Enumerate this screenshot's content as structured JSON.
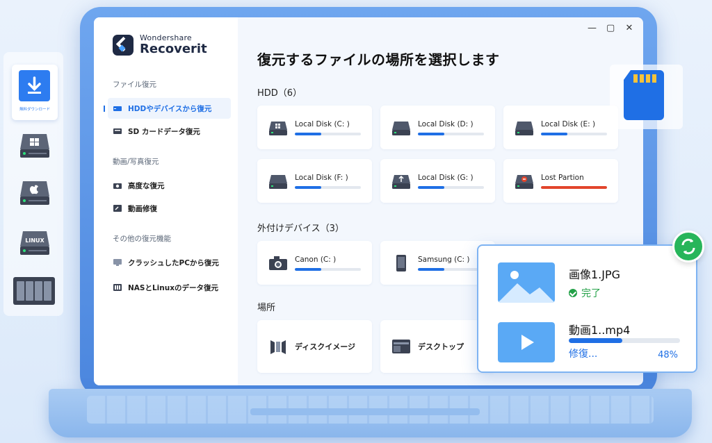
{
  "app": {
    "brand_top": "Wondershare",
    "brand_bottom": "Recoverit",
    "window_controls": {
      "minimize": "—",
      "maximize": "▢",
      "close": "✕"
    }
  },
  "sidebar": {
    "sections": [
      {
        "heading": "ファイル復元",
        "items": [
          {
            "label": "HDDやデバイスから復元",
            "icon": "hdd-icon",
            "active": true
          },
          {
            "label": "SD カードデータ復元",
            "icon": "sd-card-icon",
            "active": false
          }
        ]
      },
      {
        "heading": "動画/写真復元",
        "items": [
          {
            "label": "高度な復元",
            "icon": "camera-icon",
            "active": false
          },
          {
            "label": "動画修復",
            "icon": "video-repair-icon",
            "active": false
          }
        ]
      },
      {
        "heading": "その他の復元機能",
        "items": [
          {
            "label": "クラッシュしたPCから復元",
            "icon": "monitor-icon",
            "active": false
          },
          {
            "label": "NASとLinuxのデータ復元",
            "icon": "nas-icon",
            "active": false
          }
        ]
      }
    ]
  },
  "main": {
    "title": "復元するファイルの場所を選択します",
    "hdd": {
      "heading": "HDD（6）",
      "disks": [
        {
          "label": "Local Disk (C: )",
          "icon": "windows-disk-icon",
          "usage": 0.4,
          "color": "#1f6fe5"
        },
        {
          "label": "Local Disk (D: )",
          "icon": "disk-icon",
          "usage": 0.4,
          "color": "#1f6fe5"
        },
        {
          "label": "Local Disk (E: )",
          "icon": "disk-icon",
          "usage": 0.4,
          "color": "#1f6fe5"
        },
        {
          "label": "Local Disk (F: )",
          "icon": "disk-icon",
          "usage": 0.4,
          "color": "#1f6fe5"
        },
        {
          "label": "Local Disk (G: )",
          "icon": "usb-disk-icon",
          "usage": 0.4,
          "color": "#1f6fe5"
        },
        {
          "label": "Lost Partion",
          "icon": "lost-partition-icon",
          "usage": 1.0,
          "color": "#e2452c"
        }
      ]
    },
    "external": {
      "heading": "外付けデバイス（3）",
      "devices": [
        {
          "label": "Canon (C: )",
          "icon": "camera-device-icon",
          "usage": 0.4
        },
        {
          "label": "Samsung (C: )",
          "icon": "phone-device-icon",
          "usage": 0.4
        }
      ]
    },
    "locations": {
      "heading": "場所",
      "items": [
        {
          "label": "ディスクイメージ",
          "icon": "disk-image-icon"
        },
        {
          "label": "デスクトップ",
          "icon": "desktop-icon"
        }
      ]
    }
  },
  "dock": {
    "download_label": "無料ダウンロード"
  },
  "popup": {
    "file1": {
      "name": "画像1.JPG",
      "status": "完了"
    },
    "file2": {
      "name": "動画1..mp4",
      "status": "修復...",
      "progress": 0.48,
      "percent_text": "48%"
    }
  },
  "colors": {
    "accent": "#1f6fe5",
    "error": "#e2452c",
    "success": "#24a148"
  }
}
